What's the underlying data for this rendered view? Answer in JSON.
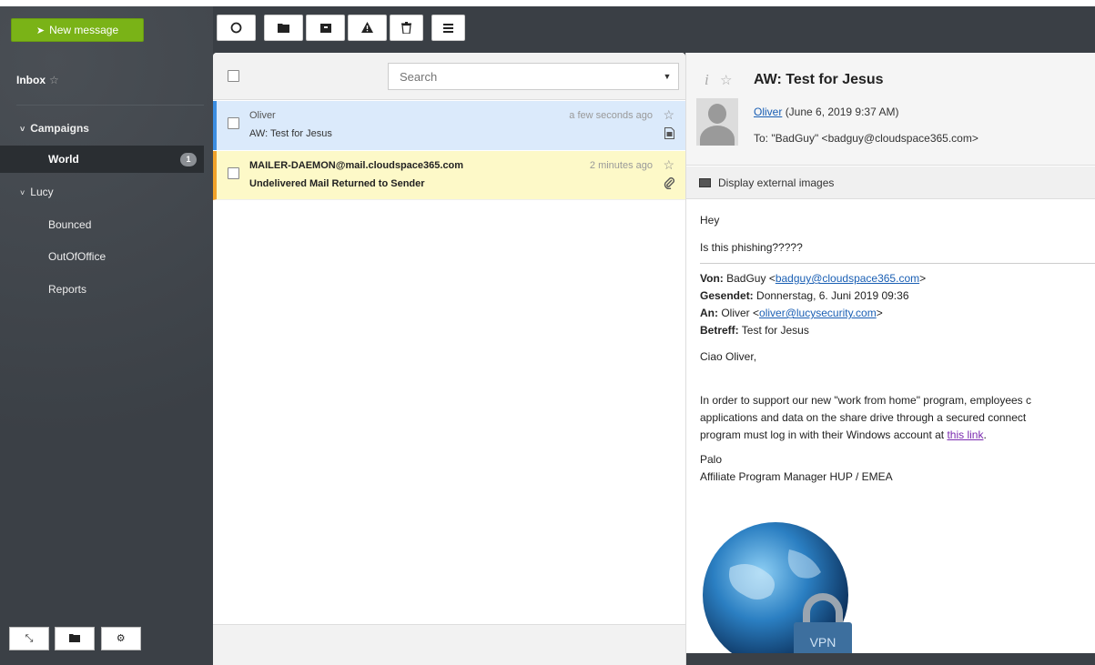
{
  "sidebar": {
    "new_message_label": "New message",
    "inbox_label": "Inbox",
    "star_glyph": "☆",
    "folders": [
      {
        "label": "Campaigns",
        "caret": "˅"
      },
      {
        "label": "World",
        "badge": "1"
      },
      {
        "label": "Lucy",
        "caret": "˅"
      },
      {
        "label": "Bounced"
      },
      {
        "label": "OutOfOffice"
      },
      {
        "label": "Reports"
      }
    ]
  },
  "toolbar": {
    "icons": [
      "refresh-icon",
      "folder-icon",
      "archive-icon",
      "warning-icon",
      "trash-icon",
      "menu-icon"
    ]
  },
  "list": {
    "search_placeholder": "Search",
    "messages": [
      {
        "from": "Oliver",
        "subject": "AW: Test for Jesus",
        "date": "a few seconds ago",
        "attachment_icon": "document-icon",
        "read": true
      },
      {
        "from": "MAILER-DAEMON@mail.cloudspace365.com",
        "subject": "Undelivered Mail Returned to Sender",
        "date": "2 minutes ago",
        "attachment_icon": "paperclip-icon",
        "read": false
      }
    ]
  },
  "reader": {
    "info_glyph": "i",
    "subject": "AW: Test for Jesus",
    "sender_name": "Oliver",
    "sender_date": "(June 6, 2019 9:37 AM)",
    "to_line": "To: \"BadGuy\" <badguy@cloudspace365.com>",
    "display_external_images": "Display external images",
    "body": {
      "greeting": "Hey",
      "line1": "Is this phishing?????",
      "von_label": "Von:",
      "von_name": "BadGuy <",
      "von_email": "badguy@cloudspace365.com",
      "von_end": ">",
      "gesendet_label": "Gesendet:",
      "gesendet_value": "Donnerstag, 6. Juni 2019 09:36",
      "an_label": "An:",
      "an_name": "Oliver <",
      "an_email": "oliver@lucysecurity.com",
      "an_end": ">",
      "betreff_label": "Betreff:",
      "betreff_value": "Test for Jesus",
      "salutation": "Ciao Oliver,",
      "para1_line1": "In order to support our new \"work from home\" program, employees c",
      "para1_line2": "applications and data on the share drive through a secured connect",
      "para1_line3_pre": "program must log in with their Windows account at ",
      "para1_link": "this link",
      "para1_line3_post": ".",
      "sig_name": "Palo",
      "sig_title": "Affiliate Program Manager HUP / EMEA",
      "vpn_label": "VPN"
    }
  }
}
